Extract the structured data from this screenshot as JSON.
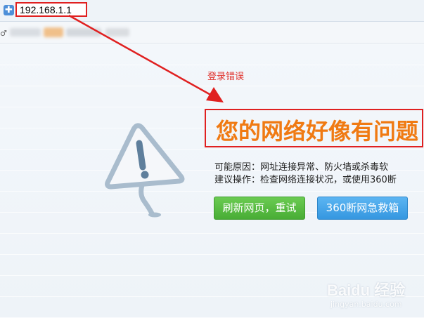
{
  "address_bar": {
    "url": "192.168.1.1",
    "security_icon": "shield-icon"
  },
  "bookmarks_bar": {
    "leading_glyph": "♂"
  },
  "annotation": {
    "login_error": "登录错误",
    "arrow_color": "#e02020"
  },
  "error_page": {
    "title": "您的网络好像有问题",
    "possible_causes": "可能原因：网址连接异常、防火墙或杀毒软",
    "suggested_actions": "建议操作：检查网络连接状况，或使用360断",
    "refresh_button": "刷新网页，重试",
    "rescue_button": "360断网急救箱",
    "icon": "warning-sign-icon"
  },
  "watermark": {
    "logo": "Baidu 经验",
    "url": "jingyan.baidu.com"
  },
  "colors": {
    "title": "#f07a12",
    "highlight_border": "#e02020",
    "refresh_button": "#48ad35",
    "rescue_button": "#3597e0"
  }
}
